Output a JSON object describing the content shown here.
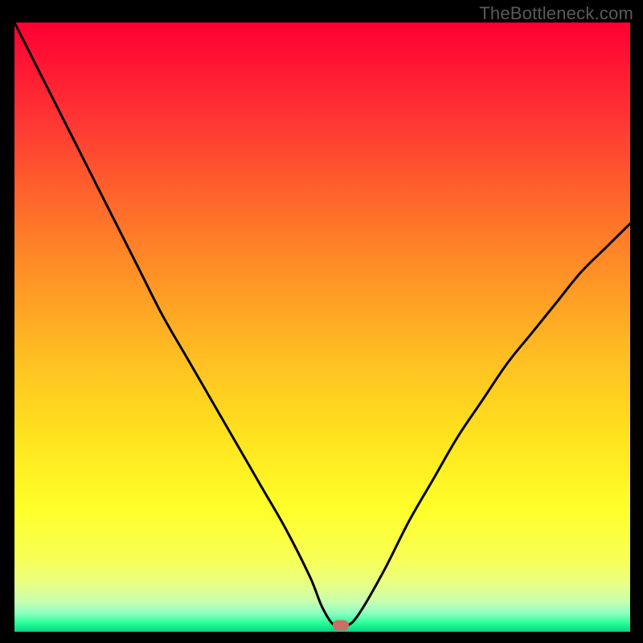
{
  "watermark": "TheBottleneck.com",
  "colors": {
    "black": "#000000",
    "curve": "#000000",
    "marker": "#cc6e66",
    "gradient_top": "#ff0033",
    "gradient_bottom": "#03d682"
  },
  "chart_data": {
    "type": "line",
    "title": "",
    "xlabel": "",
    "ylabel": "",
    "xlim": [
      0,
      100
    ],
    "ylim": [
      0,
      100
    ],
    "annotations": [
      {
        "label": "optimal-marker",
        "x": 53,
        "y": 1
      }
    ],
    "series": [
      {
        "name": "bottleneck-curve",
        "x": [
          0,
          4,
          8,
          12,
          16,
          20,
          24,
          28,
          32,
          36,
          40,
          44,
          48,
          50,
          52,
          54,
          56,
          60,
          64,
          68,
          72,
          76,
          80,
          84,
          88,
          92,
          96,
          100
        ],
        "y": [
          100,
          92,
          84,
          76,
          68,
          60,
          52,
          45,
          38,
          31,
          24,
          17,
          9,
          4,
          1,
          1,
          3,
          10,
          18,
          25,
          32,
          38,
          44,
          49,
          54,
          59,
          63,
          67
        ]
      }
    ]
  }
}
